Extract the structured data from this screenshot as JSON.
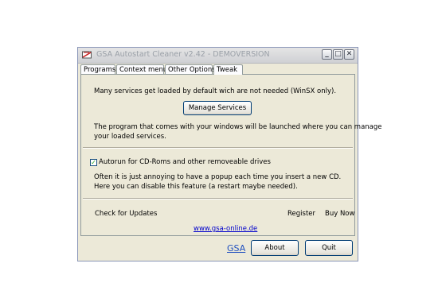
{
  "window": {
    "title": "GSA Autostart Cleaner v2.42 - DEMOVERSION",
    "minimize_glyph": "_",
    "maximize_glyph": "□",
    "close_glyph": "✕"
  },
  "tabs": [
    {
      "label": "Programs"
    },
    {
      "label": "Context menu"
    },
    {
      "label": "Other Options"
    },
    {
      "label": "Tweak"
    }
  ],
  "services": {
    "description": "Many services get loaded by default wich are not needed (WinSX only).",
    "manage_button": "Manage Services",
    "info_line1": "The program that comes with your windows will be launched where you can manage",
    "info_line2": "your loaded services."
  },
  "autorun": {
    "checkbox_checked": true,
    "checkbox_label": "Autorun for CD-Roms and other removeable drives",
    "info_line1": "Often it is just annoying to have a popup each time you insert a new CD.",
    "info_line2": "Here you can disable this feature (a restart maybe needed)."
  },
  "footer_links": {
    "check_updates": "Check for Updates",
    "register": "Register",
    "buy_now": "Buy Now",
    "website": "www.gsa-online.de"
  },
  "bottom": {
    "gsa_link": "GSA",
    "about_button": "About",
    "quit_button": "Quit"
  },
  "colors": {
    "window_bg": "#ece9d8",
    "link": "#0000cc",
    "check": "#21a121"
  }
}
